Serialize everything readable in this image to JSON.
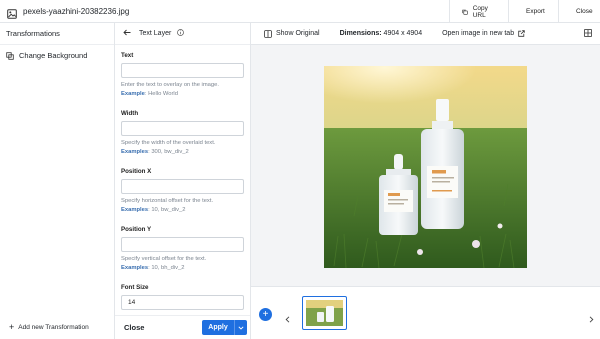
{
  "header": {
    "file_name": "pexels-yaazhini-20382236.jpg",
    "copy_url": "Copy URL",
    "export": "Export",
    "close": "Close"
  },
  "sidebar": {
    "title": "Transformations",
    "items": [
      {
        "label": "Change Background",
        "icon": "layers-icon"
      }
    ],
    "add_label": "Add new Transformation"
  },
  "panel": {
    "title": "Text Layer",
    "fields": [
      {
        "label": "Text",
        "value": "",
        "help": "Enter the text to overlay on the image.",
        "example_label": "Example",
        "example_value": "Hello World"
      },
      {
        "label": "Width",
        "value": "",
        "help": "Specify the width of the overlaid text.",
        "example_label": "Examples",
        "example_value": "300, bw_div_2"
      },
      {
        "label": "Position X",
        "value": "",
        "help": "Specify horizontal offset for the text.",
        "example_label": "Examples",
        "example_value": "10, bw_div_2"
      },
      {
        "label": "Position Y",
        "value": "",
        "help": "Specify vertical offset for the text.",
        "example_label": "Examples",
        "example_value": "10, bh_div_2"
      },
      {
        "label": "Font Size",
        "value": "14",
        "help": "",
        "example_label": "",
        "example_value": ""
      }
    ],
    "close_label": "Close",
    "apply_label": "Apply"
  },
  "main": {
    "show_original": "Show Original",
    "dimensions_label": "Dimensions:",
    "dimensions_value": "4904 x 4904",
    "open_new_tab": "Open image in new tab"
  },
  "colors": {
    "accent": "#1f6fe0",
    "border": "#e3e6ea",
    "canvas_bg": "#f3f4f6"
  }
}
